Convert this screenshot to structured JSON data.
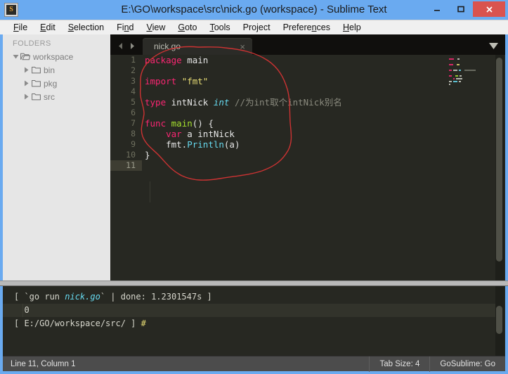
{
  "window": {
    "title": "E:\\GO\\workspace\\src\\nick.go (workspace) - Sublime Text",
    "app_icon": "sublime-text-icon",
    "app_icon_glyph": "S",
    "controls": {
      "minimize": "minimize-icon",
      "maximize": "maximize-icon",
      "close": "close-icon"
    },
    "colors": {
      "frame": "#6aaaf0",
      "close_button": "#d9534f",
      "editor_bg": "#272822",
      "sidebar_bg": "#e6e6e6",
      "status_bg": "#4c4c4c",
      "annotation": "#cc3333"
    }
  },
  "menubar": {
    "items": [
      {
        "label": "File",
        "accel_index": 0
      },
      {
        "label": "Edit",
        "accel_index": 0
      },
      {
        "label": "Selection",
        "accel_index": 0
      },
      {
        "label": "Find",
        "accel_index": 2
      },
      {
        "label": "View",
        "accel_index": 0
      },
      {
        "label": "Goto",
        "accel_index": 0
      },
      {
        "label": "Tools",
        "accel_index": 0
      },
      {
        "label": "Project",
        "accel_index": -1
      },
      {
        "label": "Preferences",
        "accel_index": 8
      },
      {
        "label": "Help",
        "accel_index": 0
      }
    ]
  },
  "sidebar": {
    "header": "FOLDERS",
    "tree": [
      {
        "label": "workspace",
        "level": 1,
        "expanded": true,
        "icon": "folder-open-icon",
        "triangle": "chevron-down-icon"
      },
      {
        "label": "bin",
        "level": 2,
        "expanded": false,
        "icon": "folder-icon",
        "triangle": "chevron-right-icon"
      },
      {
        "label": "pkg",
        "level": 2,
        "expanded": false,
        "icon": "folder-icon",
        "triangle": "chevron-right-icon"
      },
      {
        "label": "src",
        "level": 2,
        "expanded": false,
        "icon": "folder-icon",
        "triangle": "chevron-right-icon"
      }
    ]
  },
  "tabbar": {
    "prev_icon": "arrow-left-icon",
    "next_icon": "arrow-right-icon",
    "menu_icon": "chevron-down-icon",
    "tabs": [
      {
        "label": "nick.go",
        "active": true,
        "close_glyph": "×"
      }
    ]
  },
  "editor": {
    "active_line": 11,
    "line_numbers": [
      "1",
      "2",
      "3",
      "4",
      "5",
      "6",
      "7",
      "8",
      "9",
      "10",
      "11"
    ],
    "lines": [
      {
        "n": 1,
        "tokens": [
          {
            "t": "package",
            "c": "kw"
          },
          {
            "t": " ",
            "c": "plain"
          },
          {
            "t": "main",
            "c": "plain"
          }
        ]
      },
      {
        "n": 2,
        "tokens": []
      },
      {
        "n": 3,
        "tokens": [
          {
            "t": "import",
            "c": "kw"
          },
          {
            "t": " ",
            "c": "plain"
          },
          {
            "t": "\"fmt\"",
            "c": "str"
          }
        ]
      },
      {
        "n": 4,
        "tokens": []
      },
      {
        "n": 5,
        "tokens": [
          {
            "t": "type",
            "c": "kw"
          },
          {
            "t": " intNick ",
            "c": "plain"
          },
          {
            "t": "int",
            "c": "type"
          },
          {
            "t": " ",
            "c": "plain"
          },
          {
            "t": "//为int取个intNick别名",
            "c": "cmt"
          }
        ]
      },
      {
        "n": 6,
        "tokens": []
      },
      {
        "n": 7,
        "tokens": [
          {
            "t": "func",
            "c": "kw"
          },
          {
            "t": " ",
            "c": "plain"
          },
          {
            "t": "main",
            "c": "fn"
          },
          {
            "t": "() {",
            "c": "plain"
          }
        ]
      },
      {
        "n": 8,
        "tokens": [
          {
            "t": "    ",
            "c": "plain"
          },
          {
            "t": "var",
            "c": "kw"
          },
          {
            "t": " a intNick",
            "c": "plain"
          }
        ]
      },
      {
        "n": 9,
        "tokens": [
          {
            "t": "    fmt.",
            "c": "plain"
          },
          {
            "t": "Println",
            "c": "call"
          },
          {
            "t": "(a)",
            "c": "plain"
          }
        ]
      },
      {
        "n": 10,
        "tokens": [
          {
            "t": "}",
            "c": "plain"
          }
        ]
      },
      {
        "n": 11,
        "tokens": []
      }
    ],
    "minimap": "code-minimap"
  },
  "console": {
    "lines": [
      {
        "highlight": false,
        "guide": false,
        "parts": [
          {
            "t": "[ `go run ",
            "c": "co-plain"
          },
          {
            "t": "nick.go",
            "c": "co-cyan"
          },
          {
            "t": "` | done: 1.2301547s ]",
            "c": "co-plain"
          }
        ]
      },
      {
        "highlight": true,
        "guide": true,
        "parts": [
          {
            "t": "  0",
            "c": "co-plain"
          }
        ]
      },
      {
        "highlight": false,
        "guide": false,
        "parts": [
          {
            "t": "[ E:/GO/workspace/src/ ] ",
            "c": "co-plain"
          },
          {
            "t": "#",
            "c": "co-yellow"
          }
        ]
      }
    ]
  },
  "statusbar": {
    "position": "Line 11, Column 1",
    "tab_size": "Tab Size: 4",
    "syntax": "GoSublime: Go"
  }
}
